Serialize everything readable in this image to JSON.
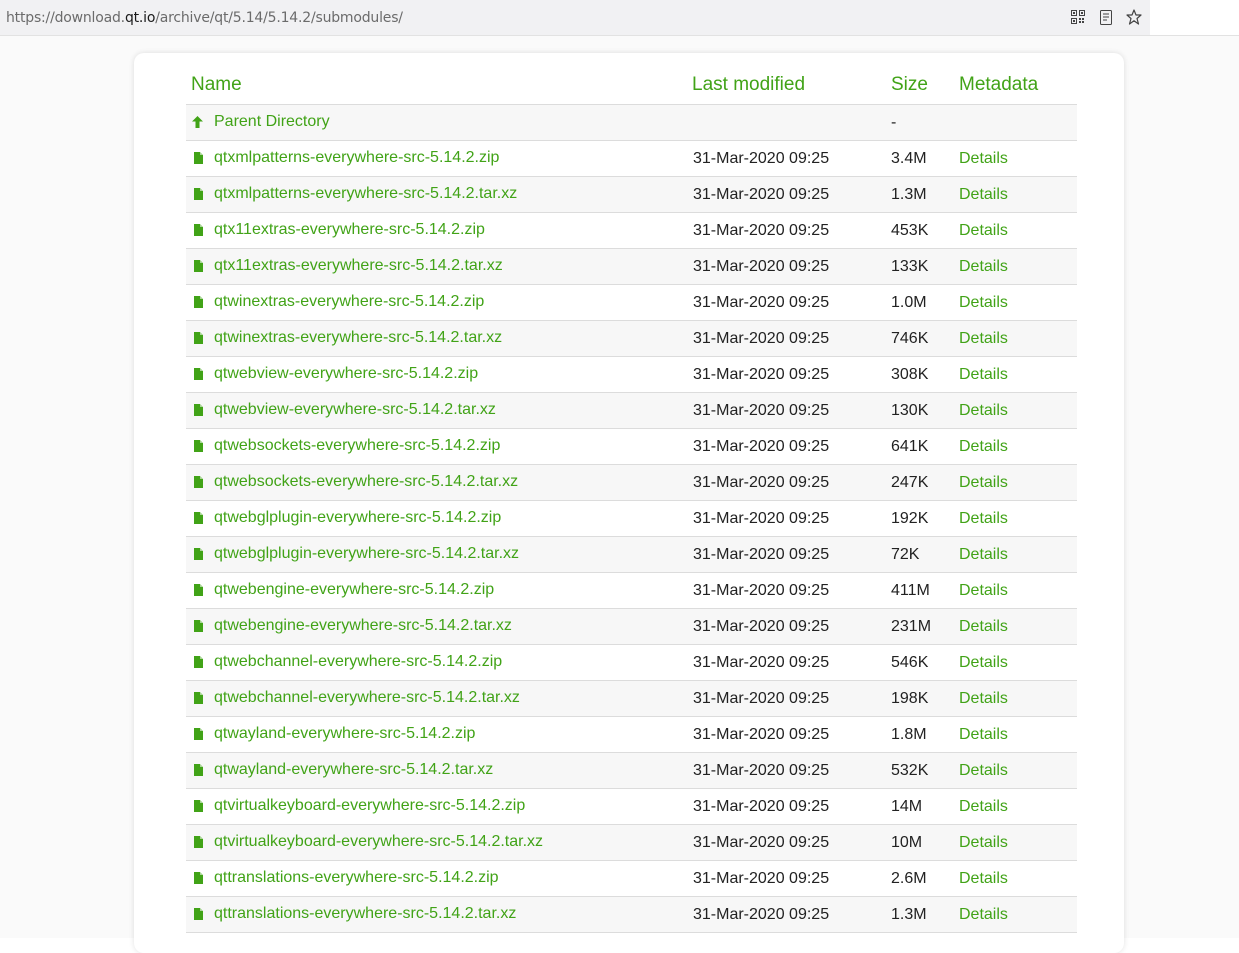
{
  "browser": {
    "url_prefix": "https://download.",
    "url_host": "qt.io",
    "url_path": "/archive/qt/5.14/5.14.2/submodules/",
    "icons": [
      "qr-code-icon",
      "reader-mode-icon",
      "bookmark-star-icon"
    ]
  },
  "colors": {
    "link": "#41a317",
    "text": "#222222"
  },
  "table": {
    "headers": {
      "name": "Name",
      "last_modified": "Last modified",
      "size": "Size",
      "metadata": "Metadata"
    },
    "parent": {
      "label": "Parent Directory",
      "size": "-",
      "icon": "up-arrow-icon"
    },
    "rows": [
      {
        "name": "qtxmlpatterns-everywhere-src-5.14.2.zip",
        "date": "31-Mar-2020 09:25",
        "size": "3.4M",
        "meta": "Details"
      },
      {
        "name": "qtxmlpatterns-everywhere-src-5.14.2.tar.xz",
        "date": "31-Mar-2020 09:25",
        "size": "1.3M",
        "meta": "Details"
      },
      {
        "name": "qtx11extras-everywhere-src-5.14.2.zip",
        "date": "31-Mar-2020 09:25",
        "size": "453K",
        "meta": "Details"
      },
      {
        "name": "qtx11extras-everywhere-src-5.14.2.tar.xz",
        "date": "31-Mar-2020 09:25",
        "size": "133K",
        "meta": "Details"
      },
      {
        "name": "qtwinextras-everywhere-src-5.14.2.zip",
        "date": "31-Mar-2020 09:25",
        "size": "1.0M",
        "meta": "Details"
      },
      {
        "name": "qtwinextras-everywhere-src-5.14.2.tar.xz",
        "date": "31-Mar-2020 09:25",
        "size": "746K",
        "meta": "Details"
      },
      {
        "name": "qtwebview-everywhere-src-5.14.2.zip",
        "date": "31-Mar-2020 09:25",
        "size": "308K",
        "meta": "Details"
      },
      {
        "name": "qtwebview-everywhere-src-5.14.2.tar.xz",
        "date": "31-Mar-2020 09:25",
        "size": "130K",
        "meta": "Details"
      },
      {
        "name": "qtwebsockets-everywhere-src-5.14.2.zip",
        "date": "31-Mar-2020 09:25",
        "size": "641K",
        "meta": "Details"
      },
      {
        "name": "qtwebsockets-everywhere-src-5.14.2.tar.xz",
        "date": "31-Mar-2020 09:25",
        "size": "247K",
        "meta": "Details"
      },
      {
        "name": "qtwebglplugin-everywhere-src-5.14.2.zip",
        "date": "31-Mar-2020 09:25",
        "size": "192K",
        "meta": "Details"
      },
      {
        "name": "qtwebglplugin-everywhere-src-5.14.2.tar.xz",
        "date": "31-Mar-2020 09:25",
        "size": "72K",
        "meta": "Details"
      },
      {
        "name": "qtwebengine-everywhere-src-5.14.2.zip",
        "date": "31-Mar-2020 09:25",
        "size": "411M",
        "meta": "Details"
      },
      {
        "name": "qtwebengine-everywhere-src-5.14.2.tar.xz",
        "date": "31-Mar-2020 09:25",
        "size": "231M",
        "meta": "Details"
      },
      {
        "name": "qtwebchannel-everywhere-src-5.14.2.zip",
        "date": "31-Mar-2020 09:25",
        "size": "546K",
        "meta": "Details"
      },
      {
        "name": "qtwebchannel-everywhere-src-5.14.2.tar.xz",
        "date": "31-Mar-2020 09:25",
        "size": "198K",
        "meta": "Details"
      },
      {
        "name": "qtwayland-everywhere-src-5.14.2.zip",
        "date": "31-Mar-2020 09:25",
        "size": "1.8M",
        "meta": "Details"
      },
      {
        "name": "qtwayland-everywhere-src-5.14.2.tar.xz",
        "date": "31-Mar-2020 09:25",
        "size": "532K",
        "meta": "Details"
      },
      {
        "name": "qtvirtualkeyboard-everywhere-src-5.14.2.zip",
        "date": "31-Mar-2020 09:25",
        "size": "14M",
        "meta": "Details"
      },
      {
        "name": "qtvirtualkeyboard-everywhere-src-5.14.2.tar.xz",
        "date": "31-Mar-2020 09:25",
        "size": "10M",
        "meta": "Details"
      },
      {
        "name": "qttranslations-everywhere-src-5.14.2.zip",
        "date": "31-Mar-2020 09:25",
        "size": "2.6M",
        "meta": "Details"
      },
      {
        "name": "qttranslations-everywhere-src-5.14.2.tar.xz",
        "date": "31-Mar-2020 09:25",
        "size": "1.3M",
        "meta": "Details"
      }
    ]
  }
}
